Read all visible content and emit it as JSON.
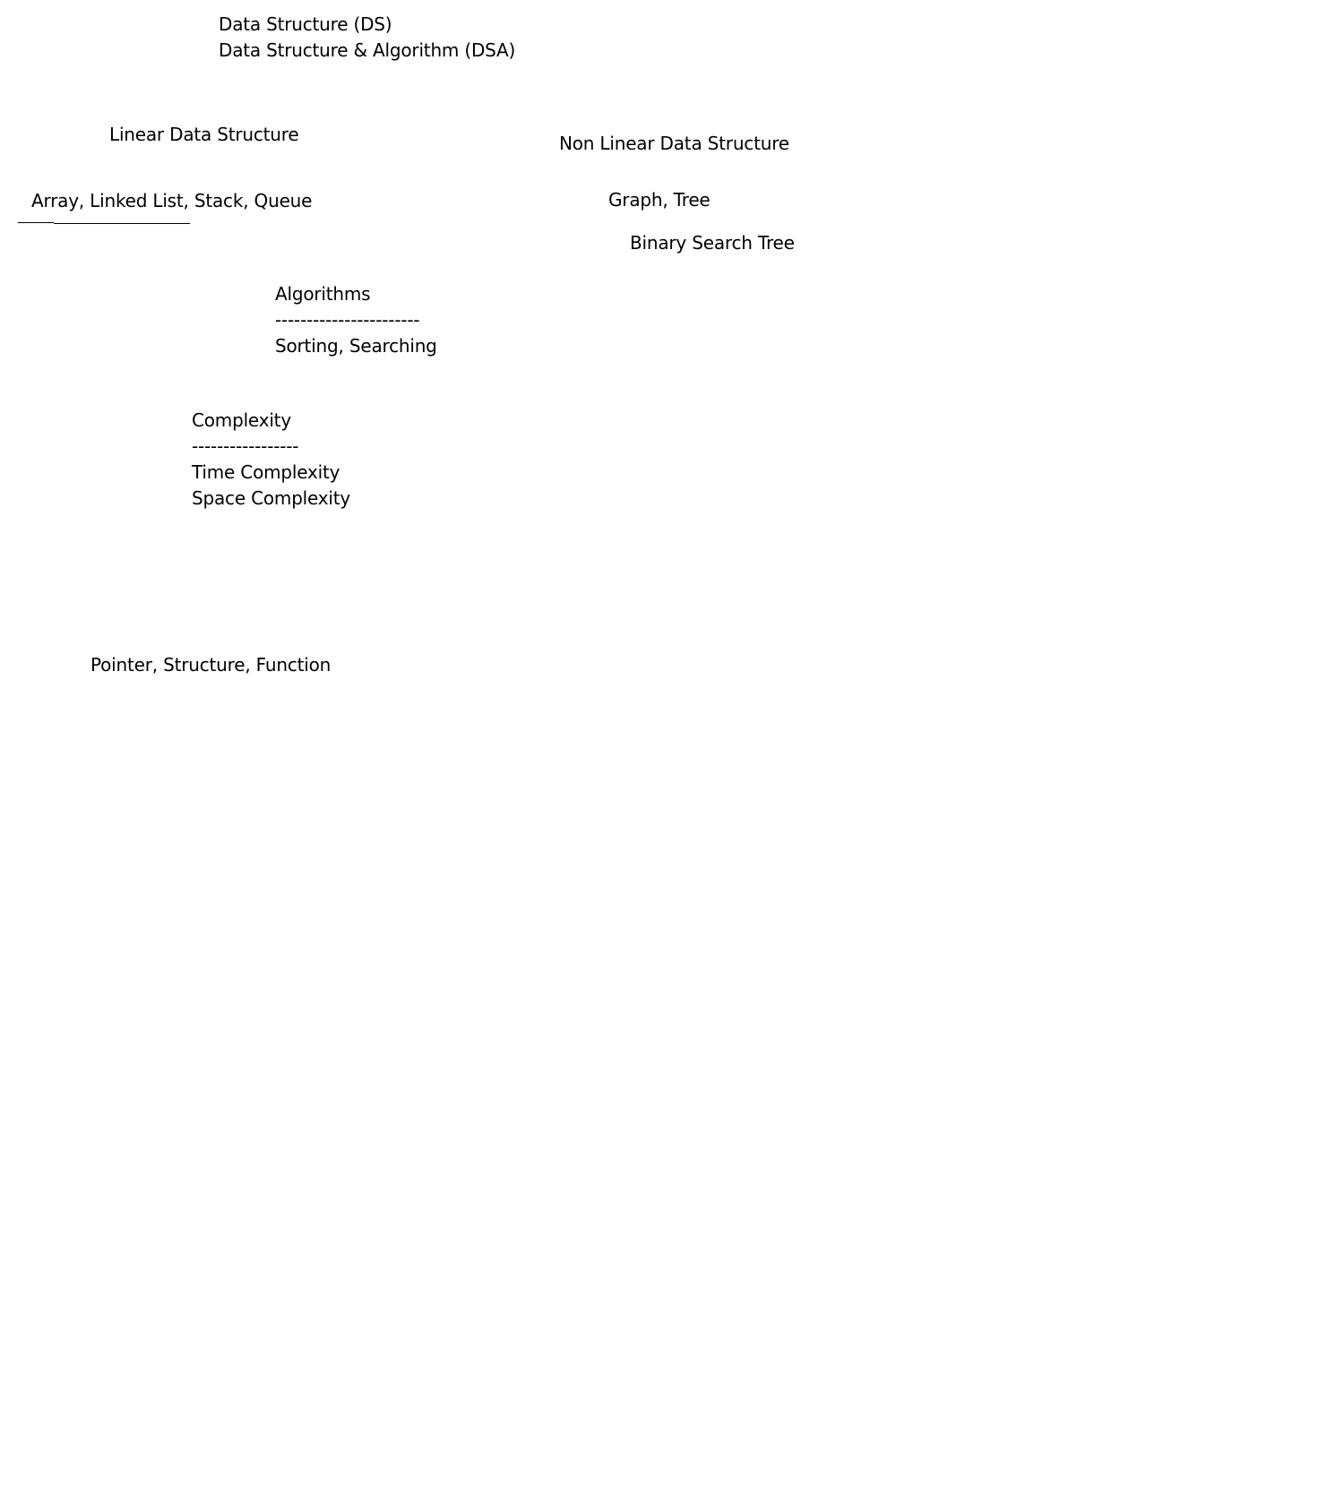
{
  "header": {
    "line1": "Data Structure (DS)",
    "line2": "Data Structure & Algorithm (DSA)"
  },
  "linear": {
    "heading": "Linear Data Structure",
    "examples": "Array, Linked List, Stack, Queue"
  },
  "non_linear": {
    "heading": "Non Linear Data Structure",
    "examples": "Graph, Tree",
    "sub_example": "Binary Search Tree"
  },
  "algorithms": {
    "heading": "Algorithms",
    "divider": "-----------------------",
    "items": "Sorting, Searching"
  },
  "complexity": {
    "heading": "Complexity",
    "divider": "-----------------",
    "item1": "Time Complexity",
    "item2": "Space Complexity"
  },
  "prerequisites": {
    "text": "Pointer, Structure, Function"
  }
}
